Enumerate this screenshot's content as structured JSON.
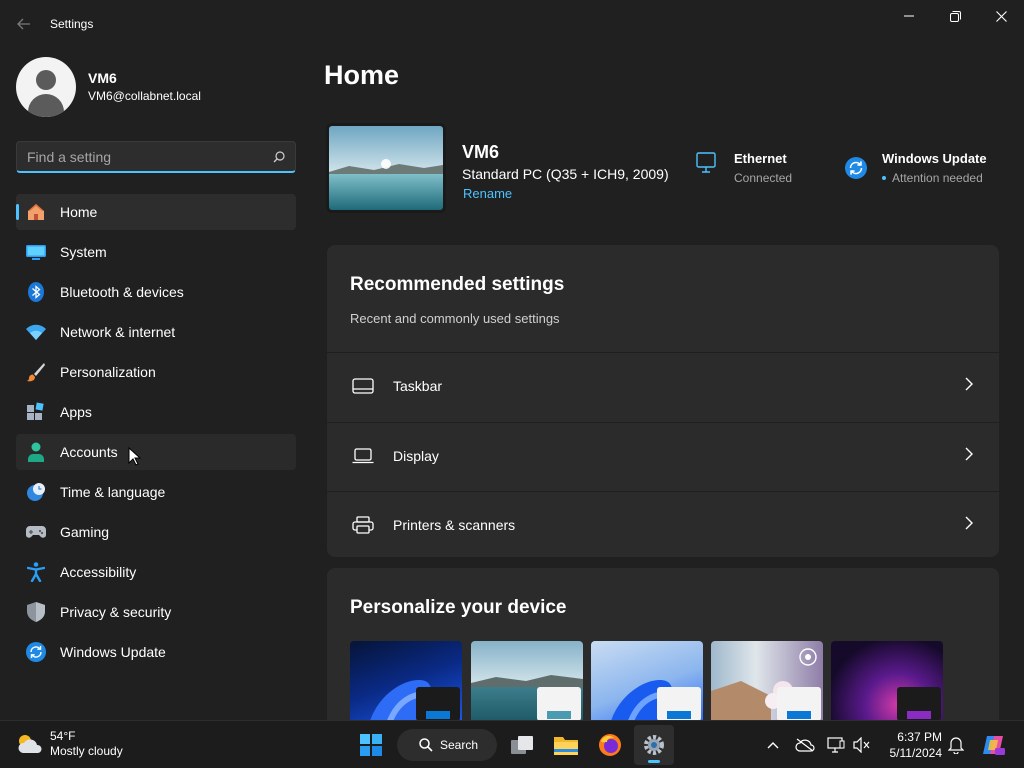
{
  "window": {
    "title": "Settings"
  },
  "profile": {
    "name": "VM6",
    "email": "VM6@collabnet.local"
  },
  "search": {
    "placeholder": "Find a setting"
  },
  "nav": [
    {
      "label": "Home",
      "icon": "home-icon",
      "selected": true
    },
    {
      "label": "System",
      "icon": "system-icon"
    },
    {
      "label": "Bluetooth & devices",
      "icon": "bluetooth-icon"
    },
    {
      "label": "Network & internet",
      "icon": "wifi-icon"
    },
    {
      "label": "Personalization",
      "icon": "brush-icon"
    },
    {
      "label": "Apps",
      "icon": "apps-icon"
    },
    {
      "label": "Accounts",
      "icon": "accounts-icon",
      "hovered": true
    },
    {
      "label": "Time & language",
      "icon": "clock-globe-icon"
    },
    {
      "label": "Gaming",
      "icon": "gamepad-icon"
    },
    {
      "label": "Accessibility",
      "icon": "accessibility-icon"
    },
    {
      "label": "Privacy & security",
      "icon": "shield-icon"
    },
    {
      "label": "Windows Update",
      "icon": "update-icon"
    }
  ],
  "main": {
    "title": "Home",
    "device": {
      "name": "VM6",
      "spec": "Standard PC (Q35 + ICH9, 2009)",
      "rename": "Rename"
    },
    "ethernet": {
      "title": "Ethernet",
      "status": "Connected"
    },
    "windows_update": {
      "title": "Windows Update",
      "status": "Attention needed"
    },
    "recommended": {
      "title": "Recommended settings",
      "subtitle": "Recent and commonly used settings",
      "items": [
        {
          "label": "Taskbar",
          "icon": "taskbar-icon"
        },
        {
          "label": "Display",
          "icon": "laptop-icon"
        },
        {
          "label": "Printers & scanners",
          "icon": "printer-icon"
        }
      ]
    },
    "personalize": {
      "title": "Personalize your device"
    }
  },
  "taskbar": {
    "weather_temp": "54°F",
    "weather_desc": "Mostly cloudy",
    "search_label": "Search",
    "time": "6:37 PM",
    "date": "5/11/2024"
  },
  "colors": {
    "accent": "#4cc2ff",
    "background": "#202020",
    "card": "#2b2b2b"
  }
}
